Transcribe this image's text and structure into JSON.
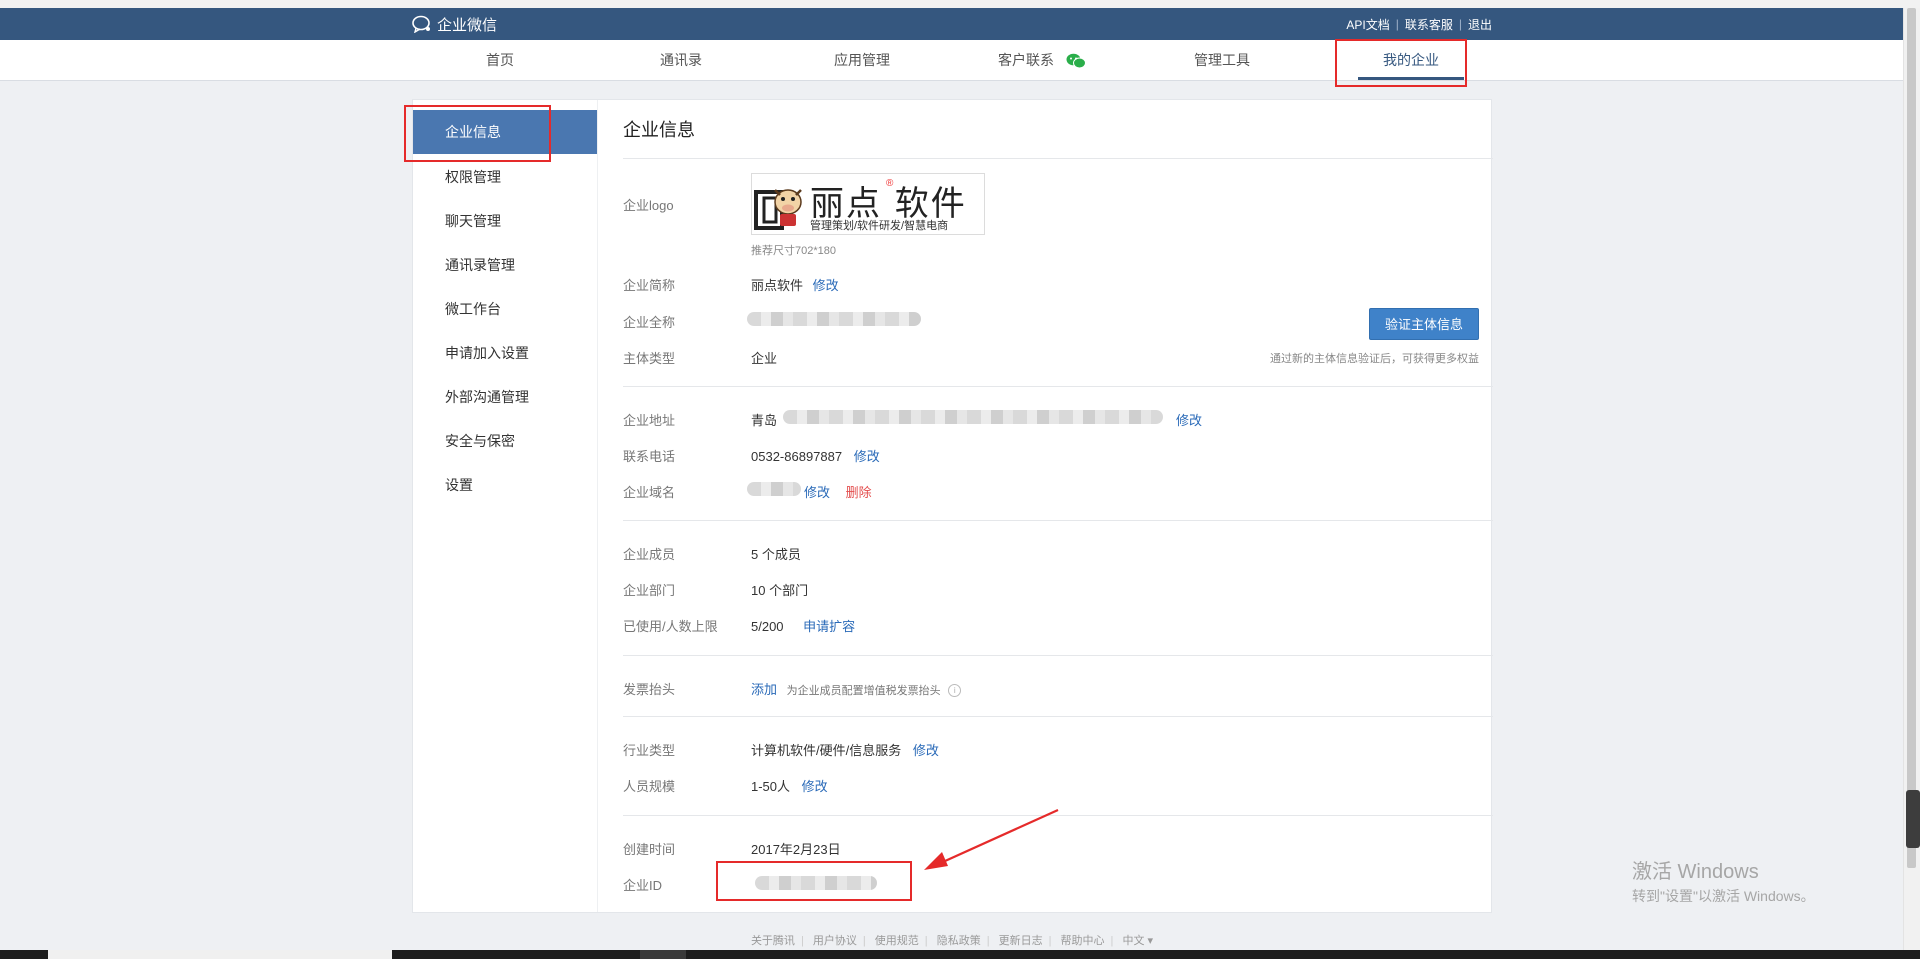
{
  "app": {
    "name": "企业微信"
  },
  "toplinks": {
    "api": "API文档",
    "service": "联系客服",
    "logout": "退出",
    "sep": "|"
  },
  "nav": {
    "home": "首页",
    "contacts": "通讯录",
    "apps": "应用管理",
    "customer": "客户联系",
    "tools": "管理工具",
    "my_company": "我的企业"
  },
  "sidebar": {
    "items": [
      "企业信息",
      "权限管理",
      "聊天管理",
      "通讯录管理",
      "微工作台",
      "申请加入设置",
      "外部沟通管理",
      "安全与保密",
      "设置"
    ]
  },
  "page": {
    "title": "企业信息",
    "logo_label": "企业logo",
    "logo_brand": "丽点 软件",
    "logo_reg": "®",
    "logo_sub": "管理策划/软件研发/智慧电商",
    "logo_hint": "推荐尺寸702*180",
    "short_name_label": "企业简称",
    "short_name": "丽点软件",
    "full_name_label": "企业全称",
    "entity_type_label": "主体类型",
    "entity_type": "企业",
    "verify_button": "验证主体信息",
    "verify_hint": "通过新的主体信息验证后，可获得更多权益",
    "address_label": "企业地址",
    "address_prefix": "青岛",
    "phone_label": "联系电话",
    "phone": "0532-86897887",
    "domain_label": "企业域名",
    "members_label": "企业成员",
    "members": "5 个成员",
    "departments_label": "企业部门",
    "departments": "10 个部门",
    "limit_label": "已使用/人数上限",
    "limit": "5/200",
    "expand_link": "申请扩容",
    "invoice_label": "发票抬头",
    "invoice_add": "添加",
    "invoice_hint": "为企业成员配置增值税发票抬头",
    "industry_label": "行业类型",
    "industry": "计算机软件/硬件/信息服务",
    "scale_label": "人员规模",
    "scale": "1-50人",
    "created_label": "创建时间",
    "created": "2017年2月23日",
    "corp_id_label": "企业ID",
    "edit": "修改",
    "delete": "删除"
  },
  "watermark": {
    "line1": "激活 Windows",
    "line2": "转到\"设置\"以激活 Windows。"
  },
  "footer": [
    "关于腾讯",
    "用户协议",
    "使用规范",
    "隐私政策",
    "更新日志",
    "帮助中心",
    "中文 ▾"
  ],
  "colors": {
    "header": "#35577f",
    "active": "#4a77b0",
    "link": "#2a6ab8",
    "highlight": "#e52a2a",
    "button": "#3f82c9"
  }
}
